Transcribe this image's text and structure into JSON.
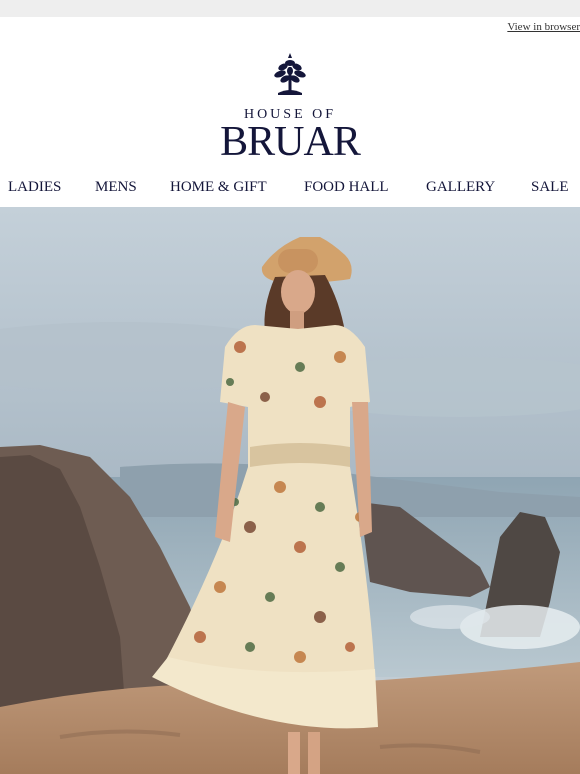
{
  "header": {
    "view_in_browser": "View in browser"
  },
  "logo": {
    "top_text": "HOUSE OF",
    "main_text": "BRUAR"
  },
  "nav": {
    "items": [
      {
        "label": "LADIES"
      },
      {
        "label": "MENS"
      },
      {
        "label": "HOME & GIFT"
      },
      {
        "label": "FOOD HALL"
      },
      {
        "label": "GALLERY"
      },
      {
        "label": "SALE"
      }
    ]
  },
  "colors": {
    "brand_navy": "#14163a",
    "topbar_gray": "#eeeeee"
  },
  "icons": {
    "logo": "tree-crest-icon"
  },
  "hero": {
    "alt": "Model in patterned summer dress and straw hat on coastal cliff"
  }
}
